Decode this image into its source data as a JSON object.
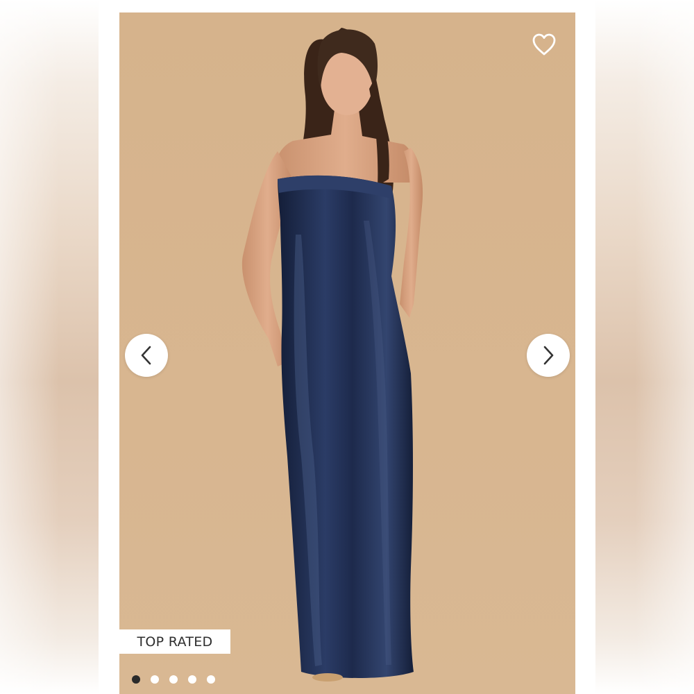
{
  "product_gallery": {
    "favorite_icon": "heart-outline-icon",
    "prev_icon": "chevron-left-icon",
    "next_icon": "chevron-right-icon",
    "badge": "TOP RATED",
    "slides": 5,
    "active_slide": 1,
    "colors": {
      "backdrop": "#d7b48e",
      "dress": "#1c2a4a",
      "active_dot": "#2a2a2a",
      "inactive_dot": "#ffffff"
    }
  }
}
